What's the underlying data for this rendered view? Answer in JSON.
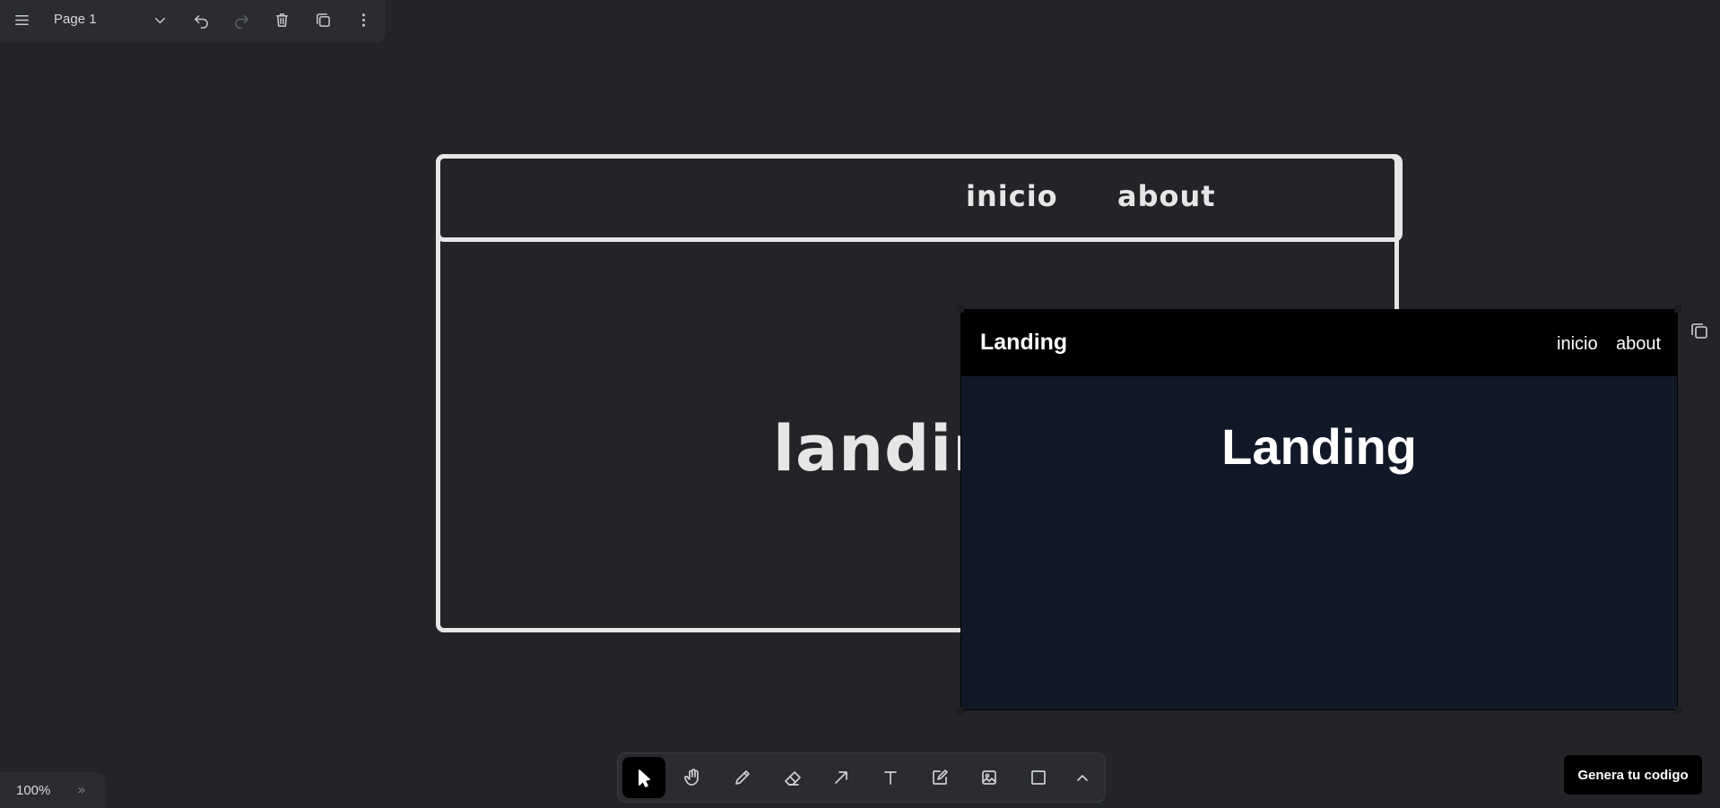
{
  "topbar": {
    "page_name": "Page 1"
  },
  "sketch": {
    "nav_inicio": "inicio",
    "nav_about": "about",
    "headline": "landin"
  },
  "preview": {
    "brand": "Landing",
    "nav_inicio": "inicio",
    "nav_about": "about",
    "title": "Landing"
  },
  "toolbar": {
    "tools": [
      "select-icon",
      "hand-icon",
      "pencil-icon",
      "eraser-icon",
      "arrow-icon",
      "text-icon",
      "note-icon",
      "image-icon",
      "rectangle-icon",
      "chevron-up-icon"
    ],
    "active": "select-icon"
  },
  "zoom": {
    "level": "100%"
  },
  "generate_button": "Genera tu codigo",
  "colors": {
    "canvas": "#222428",
    "preview_bg": "#111827",
    "preview_header": "#000000"
  }
}
